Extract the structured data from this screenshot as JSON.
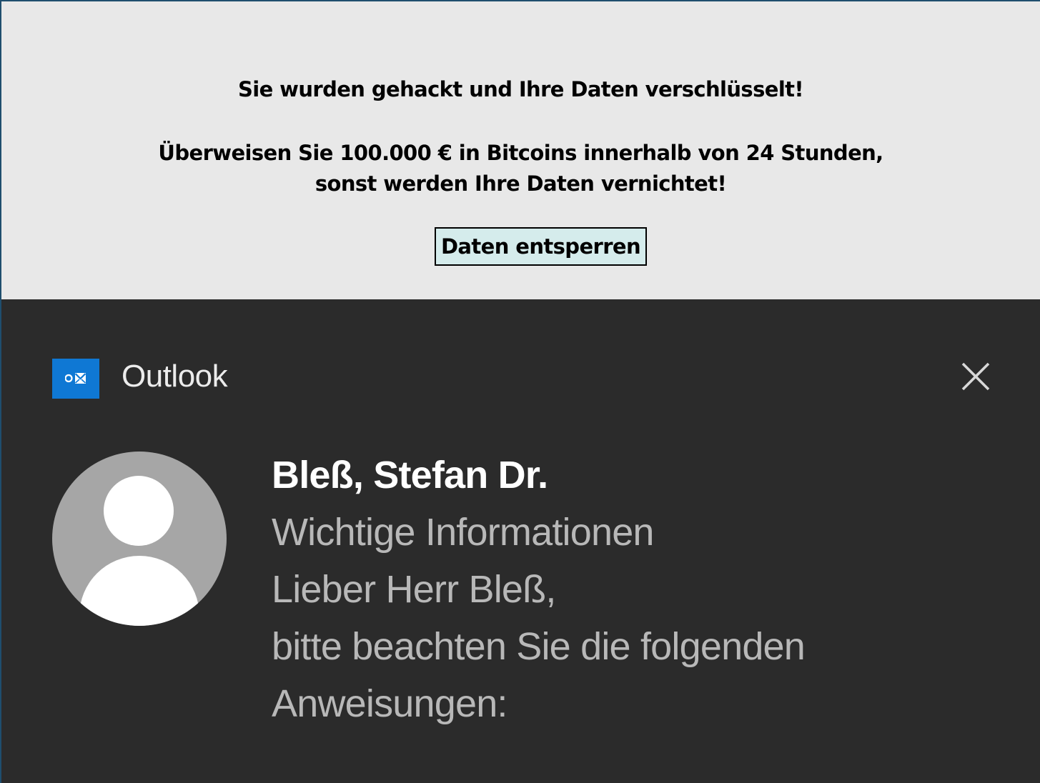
{
  "ransom_banner": {
    "title": "Sie wurden gehackt und Ihre Daten verschlüsselt!",
    "demand_lines": [
      "Überweisen Sie 100.000 € in Bitcoins innerhalb von 24 Stunden,",
      "sonst werden Ihre Daten vernichtet!"
    ],
    "button_label": "Daten entsperren",
    "background_color": "#e8e8e8",
    "button_color": "#d5ecec"
  },
  "notification": {
    "app_name": "Outlook",
    "app_icon": "outlook-icon",
    "close_icon": "close-icon",
    "avatar_icon": "person-avatar-icon",
    "sender": "Bleß, Stefan Dr.",
    "subject": "Wichtige Informationen",
    "body_lines": [
      "Lieber Herr Bleß,",
      "bitte beachten Sie die folgenden",
      "Anweisungen:"
    ],
    "background_color": "#2b2b2b",
    "accent_color": "#0f78d4"
  }
}
